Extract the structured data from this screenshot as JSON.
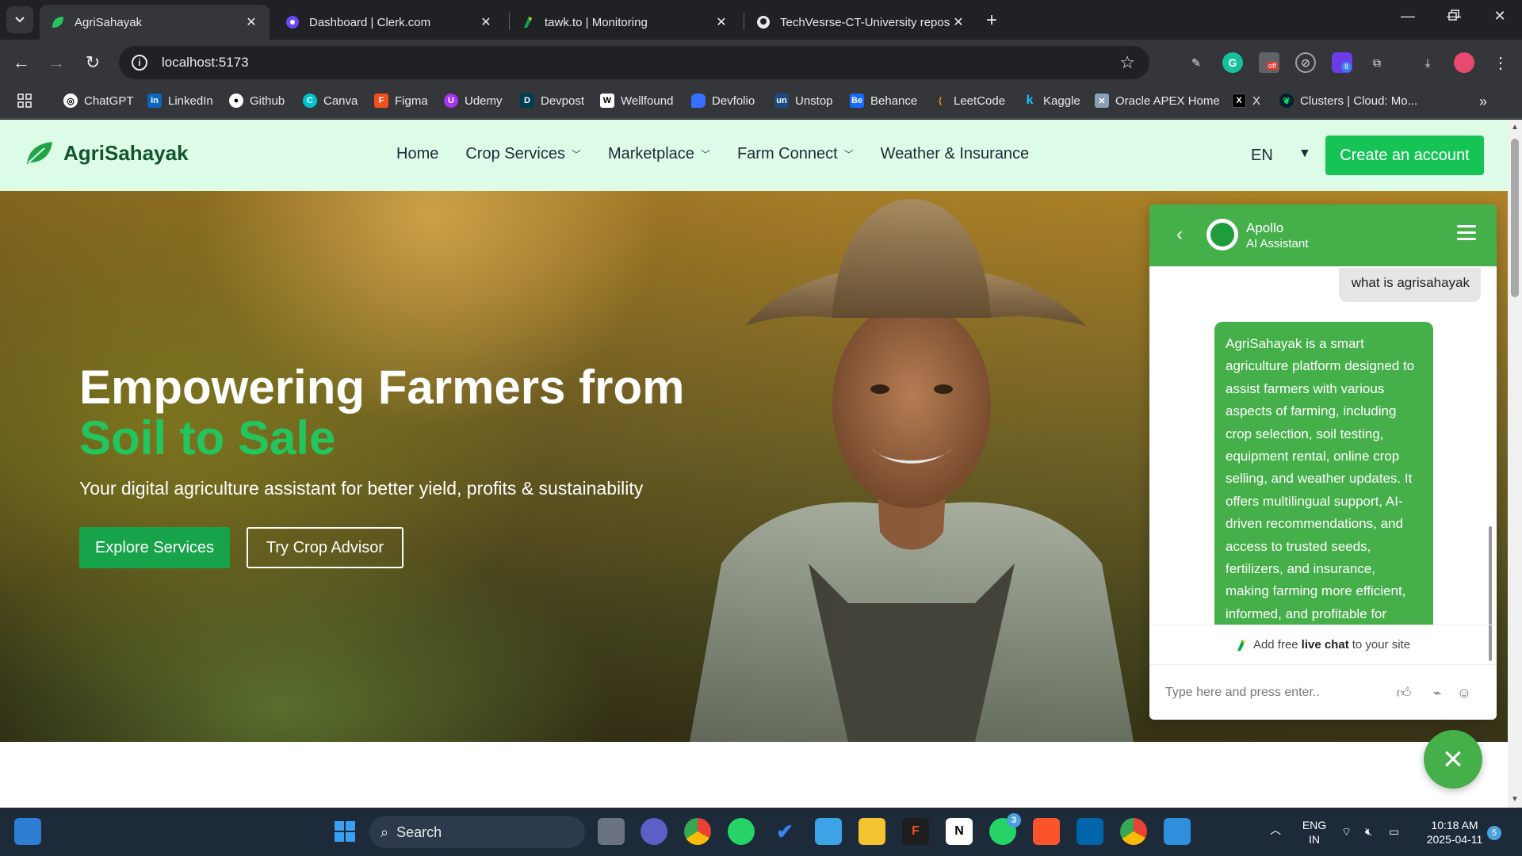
{
  "browser": {
    "tabs": [
      {
        "title": "AgriSahayak",
        "active": true
      },
      {
        "title": "Dashboard | Clerk.com",
        "active": false
      },
      {
        "title": "tawk.to | Monitoring",
        "active": false
      },
      {
        "title": "TechVesrse-CT-University repos",
        "active": false
      }
    ],
    "new_tab_icon": "plus",
    "url": "localhost:5173",
    "bookmarks": [
      {
        "label": "ChatGPT",
        "color": "#ffffff"
      },
      {
        "label": "LinkedIn",
        "color": "#0a66c2"
      },
      {
        "label": "Github",
        "color": "#ffffff"
      },
      {
        "label": "Canva",
        "color": "#00c4cc"
      },
      {
        "label": "Figma",
        "color": "#f24e1e"
      },
      {
        "label": "Udemy",
        "color": "#a435f0"
      },
      {
        "label": "Devpost",
        "color": "#003e54"
      },
      {
        "label": "Wellfound",
        "color": "#ffffff"
      },
      {
        "label": "Devfolio",
        "color": "#3770ff"
      },
      {
        "label": "Unstop",
        "color": "#1c4980"
      },
      {
        "label": "Behance",
        "color": "#1769ff"
      },
      {
        "label": "LeetCode",
        "color": "#ffa116"
      },
      {
        "label": "Kaggle",
        "color": "#20beff"
      },
      {
        "label": "Oracle APEX Home",
        "color": "#c74634"
      },
      {
        "label": "X",
        "color": "#000000"
      },
      {
        "label": "Clusters | Cloud: Mo...",
        "color": "#00ed64"
      }
    ],
    "extension_badges": {
      "off_label": "off",
      "count": "8"
    }
  },
  "site": {
    "brand": "AgriSahayak",
    "nav": [
      {
        "label": "Home",
        "dropdown": false
      },
      {
        "label": "Crop Services",
        "dropdown": true
      },
      {
        "label": "Marketplace",
        "dropdown": true
      },
      {
        "label": "Farm Connect",
        "dropdown": true
      },
      {
        "label": "Weather & Insurance",
        "dropdown": false
      }
    ],
    "language": "EN",
    "cta": "Create an account",
    "hero": {
      "title_line1": "Empowering Farmers from",
      "title_line2": "Soil to Sale",
      "subtitle": "Your digital agriculture assistant for better yield, profits & sustainability",
      "primary_button": "Explore Services",
      "secondary_button": "Try Crop Advisor"
    }
  },
  "chat": {
    "agent_name": "Apollo",
    "agent_role": "AI Assistant",
    "user_message": "what is agrisahayak",
    "bot_message": "AgriSahayak is a smart agriculture platform designed to assist farmers with various aspects of farming, including crop selection, soil testing, equipment rental, online crop selling, and weather updates. It offers multilingual support, AI-driven recommendations, and access to trusted seeds, fertilizers, and insurance, making farming more efficient, informed, and profitable for",
    "branding_prefix": "Add free",
    "branding_bold": "live chat",
    "branding_suffix": "to your site",
    "input_placeholder": "Type here and press enter..",
    "accent_color": "#45b04a"
  },
  "taskbar": {
    "search_label": "Search",
    "language_line1": "ENG",
    "language_line2": "IN",
    "time": "10:18 AM",
    "date": "2025-04-11",
    "notification_count": "5",
    "whatsapp_badge": "3"
  }
}
